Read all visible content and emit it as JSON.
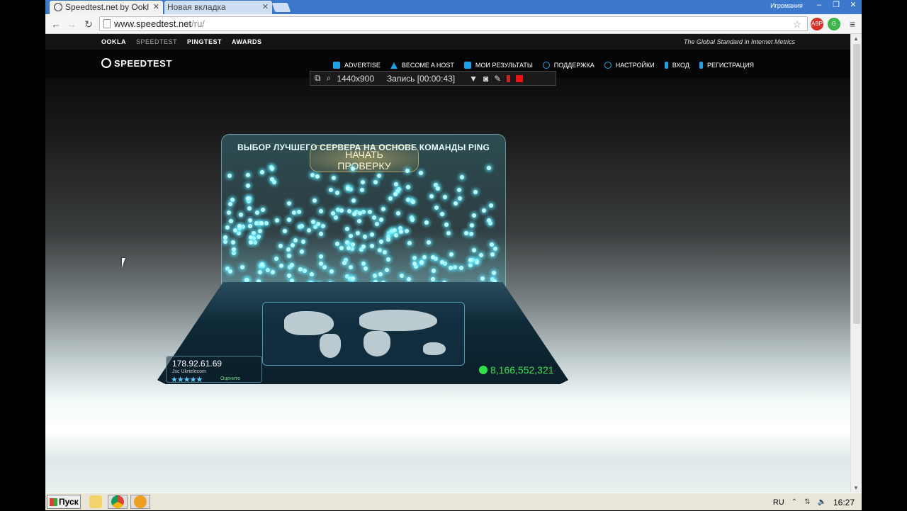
{
  "browser": {
    "tabs": [
      {
        "label": "Speedtest.net by Ookl",
        "active": true
      },
      {
        "label": "Новая вкладка",
        "active": false
      }
    ],
    "user_badge": "Игромания",
    "address": {
      "host": "www.speedtest.net",
      "path": "/ru/"
    }
  },
  "site": {
    "topnav": [
      "OOKLA",
      "SPEEDTEST",
      "PINGTEST",
      "AWARDS"
    ],
    "tagline": "The Global Standard in Internet Metrics",
    "logo": "SPEEDTEST",
    "mainnav": [
      {
        "label": "ADVERTISE",
        "icon": "megaphone-icon"
      },
      {
        "label": "BECOME A HOST",
        "icon": "triangle-icon"
      },
      {
        "label": "МОИ РЕЗУЛЬТАТЫ",
        "icon": "camera-icon"
      },
      {
        "label": "ПОДДЕРЖКА",
        "icon": "info-icon"
      },
      {
        "label": "НАСТРОЙКИ",
        "icon": "gear-icon"
      },
      {
        "label": "ВХОД",
        "icon": "person-icon"
      },
      {
        "label": "РЕГИСТРАЦИЯ",
        "icon": "person-icon"
      }
    ]
  },
  "recorder": {
    "resolution": "1440x900",
    "status": "Запись [00:00:43]"
  },
  "widget": {
    "title": "ВЫБОР ЛУЧШЕГО СЕРВЕРА НА ОСНОВЕ КОМАНДЫ PING",
    "start_line1": "НАЧАТЬ",
    "start_line2": "ПРОВЕРКУ",
    "ip": "178.92.61.69",
    "isp": "Jsc Ukrtelecom",
    "stars": "★★★★★",
    "rate_label": "Оцените",
    "counter": "8,166,552,321"
  },
  "taskbar": {
    "start": "Пуск",
    "lang": "RU",
    "clock": "16:27"
  }
}
